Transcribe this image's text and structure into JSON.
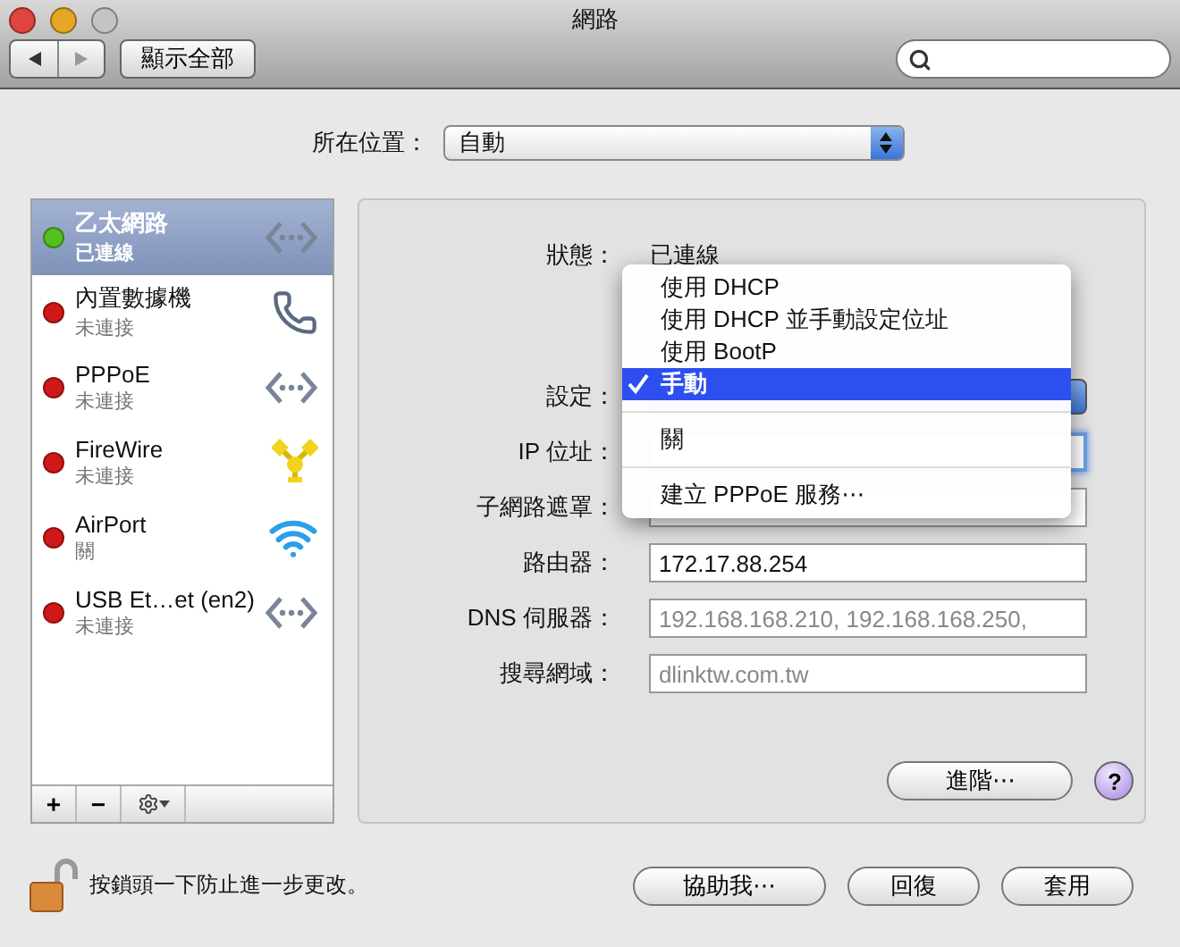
{
  "window": {
    "title": "網路"
  },
  "toolbar": {
    "show_all": "顯示全部"
  },
  "location": {
    "label": "所在位置：",
    "value": "自動"
  },
  "services": [
    {
      "name": "乙太網路",
      "status": "已連線",
      "selected": true,
      "color": "#52c020",
      "kind": "ethernet"
    },
    {
      "name": "內置數據機",
      "status": "未連接",
      "selected": false,
      "color": "#d01818",
      "kind": "phone"
    },
    {
      "name": "PPPoE",
      "status": "未連接",
      "selected": false,
      "color": "#d01818",
      "kind": "ethernet"
    },
    {
      "name": "FireWire",
      "status": "未連接",
      "selected": false,
      "color": "#d01818",
      "kind": "firewire"
    },
    {
      "name": "AirPort",
      "status": "關",
      "selected": false,
      "color": "#d01818",
      "kind": "wifi"
    },
    {
      "name": "USB Et…et (en2)",
      "status": "未連接",
      "selected": false,
      "color": "#d01818",
      "kind": "ethernet"
    }
  ],
  "sidebar_tools": [
    "+",
    "−"
  ],
  "details": {
    "status_label": "狀態：",
    "status_value": "已連線",
    "fields": [
      {
        "label": "設定：",
        "kind": "popup"
      },
      {
        "label": "IP 位址：",
        "kind": "input",
        "focused": true
      },
      {
        "label": "子網路遮罩：",
        "kind": "input",
        "focused": false
      },
      {
        "label": "路由器：",
        "kind": "input",
        "focused": false,
        "value": "172.17.88.254"
      },
      {
        "label": "DNS 伺服器：",
        "kind": "input",
        "focused": false,
        "placeholder": "192.168.168.210, 192.168.168.250,"
      },
      {
        "label": "搜尋網域：",
        "kind": "input",
        "focused": false,
        "placeholder": "dlinktw.com.tw"
      }
    ]
  },
  "menu": {
    "items": [
      {
        "kind": "item",
        "label": "使用 DHCP",
        "selected": false
      },
      {
        "kind": "item",
        "label": "使用 DHCP 並手動設定位址",
        "selected": false
      },
      {
        "kind": "item",
        "label": "使用 BootP",
        "selected": false
      },
      {
        "kind": "item",
        "label": "手動",
        "selected": true
      },
      {
        "kind": "separator"
      },
      {
        "kind": "item",
        "label": "關",
        "selected": false
      },
      {
        "kind": "separator"
      },
      {
        "kind": "item",
        "label": "建立 PPPoE 服務⋯",
        "selected": false
      }
    ]
  },
  "advanced": "進階⋯",
  "help": "?",
  "lock": {
    "text": "按鎖頭一下防止進一步更改。",
    "locked": false
  },
  "buttons": [
    "協助我⋯",
    "回復",
    "套用"
  ]
}
